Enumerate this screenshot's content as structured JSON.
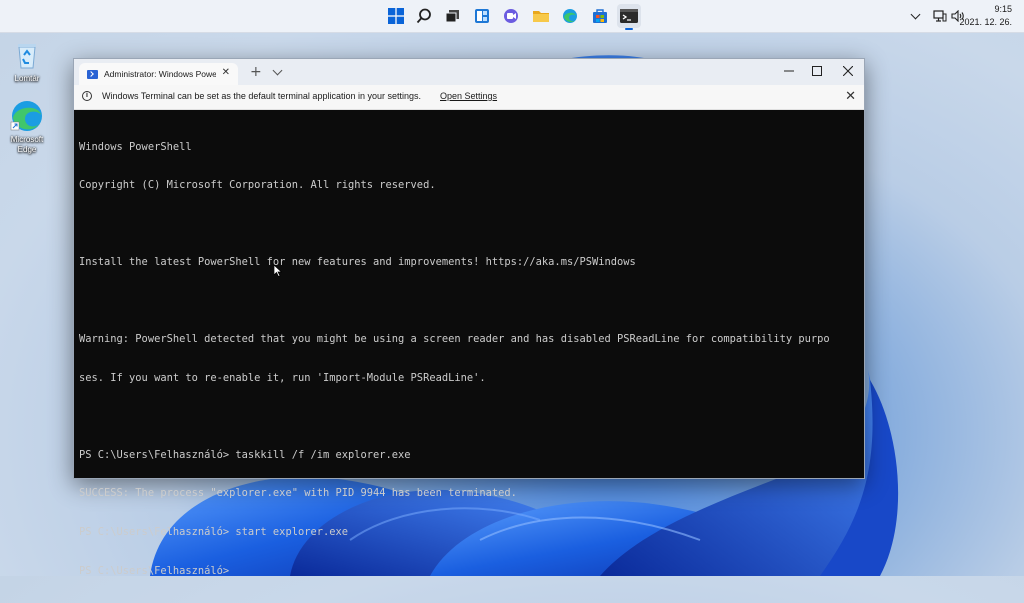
{
  "desktop": {
    "icons": [
      {
        "label": "Lomtár",
        "icon": "recycle-bin-icon"
      },
      {
        "label": "Microsoft Edge",
        "icon": "edge-icon"
      }
    ]
  },
  "taskbar": {
    "icons": [
      "start-icon",
      "search-icon",
      "task-view-icon",
      "widgets-icon",
      "chat-icon",
      "file-explorer-icon",
      "edge-icon",
      "store-icon",
      "terminal-icon"
    ],
    "tray": {
      "chevron": "chevron-up-icon",
      "network": "network-icon",
      "volume": "volume-icon"
    },
    "time": "9:15",
    "date": "2021. 12. 26."
  },
  "window": {
    "tab_title": "Administrator: Windows PowerShell",
    "new_tab": "+",
    "infobar": {
      "text": "Windows Terminal can be set as the default terminal application in your settings.",
      "link": "Open Settings"
    },
    "console_lines": [
      "Windows PowerShell",
      "Copyright (C) Microsoft Corporation. All rights reserved.",
      "",
      "Install the latest PowerShell for new features and improvements! https://aka.ms/PSWindows",
      "",
      "Warning: PowerShell detected that you might be using a screen reader and has disabled PSReadLine for compatibility purpo",
      "ses. If you want to re-enable it, run 'Import-Module PSReadLine'.",
      "",
      "PS C:\\Users\\Felhasználó> taskkill /f /im explorer.exe",
      "SUCCESS: The process \"explorer.exe\" with PID 9944 has been terminated.",
      "PS C:\\Users\\Felhasználó> start explorer.exe",
      "PS C:\\Users\\Felhasználó>"
    ]
  },
  "colors": {
    "console_bg": "#0c0c0c",
    "console_fg": "#cccccc",
    "accent": "#0a64d8"
  }
}
